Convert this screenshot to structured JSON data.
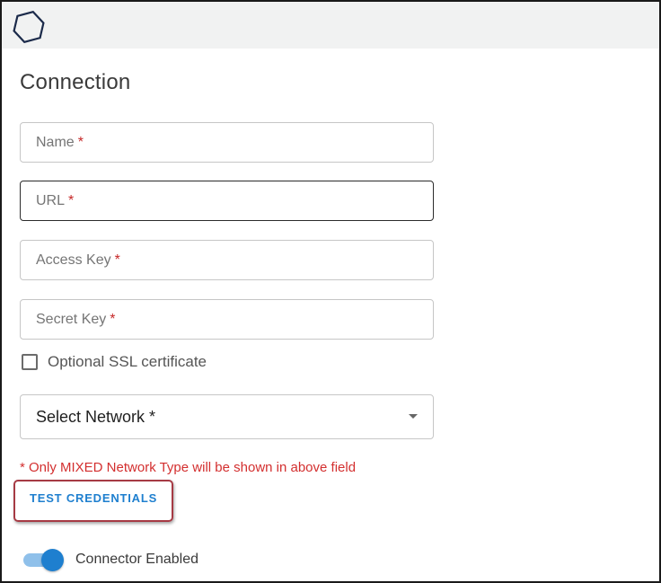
{
  "header": {
    "logo_icon": "hexagon-logo-icon"
  },
  "page": {
    "title": "Connection"
  },
  "form": {
    "name": {
      "label": "Name",
      "required_mark": "*"
    },
    "url": {
      "label": "URL",
      "required_mark": "*"
    },
    "access_key": {
      "label": "Access Key",
      "required_mark": "*"
    },
    "secret_key": {
      "label": "Secret Key",
      "required_mark": "*"
    },
    "ssl_checkbox": {
      "label": "Optional SSL certificate",
      "checked": false
    },
    "network_select": {
      "label": "Select Network *",
      "icon": "caret-down-icon"
    },
    "network_note": "* Only MIXED Network Type will be shown in above field",
    "test_button_label": "TEST CREDENTIALS",
    "connector_toggle": {
      "label": "Connector Enabled",
      "on": true
    }
  },
  "colors": {
    "accent": "#1e7fcf",
    "required": "#c62828",
    "highlight_border": "#a63a44"
  }
}
